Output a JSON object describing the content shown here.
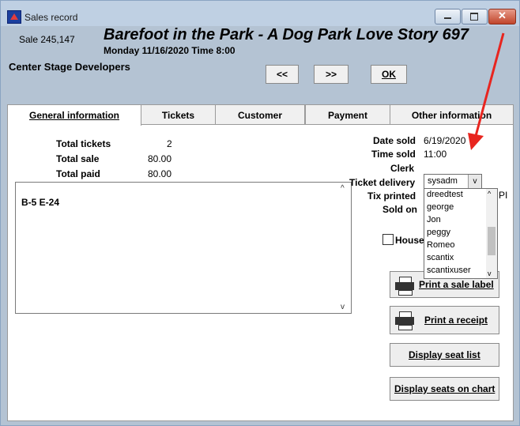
{
  "window": {
    "title": "Sales record"
  },
  "header": {
    "sale_number": "Sale 245,147",
    "show_title": "Barefoot in the Park - A Dog Park Love Story 697",
    "show_datetime": "Monday 11/16/2020  Time 8:00",
    "company": "Center Stage Developers"
  },
  "nav": {
    "prev_label": "<<",
    "next_label": ">>",
    "ok_label": "OK"
  },
  "tabs": [
    {
      "label": "General information"
    },
    {
      "label": "Tickets"
    },
    {
      "label": "Customer"
    },
    {
      "label": "Payment"
    },
    {
      "label": "Other information"
    }
  ],
  "totals": {
    "tickets_label": "Total tickets",
    "tickets_value": "2",
    "sale_label": "Total sale",
    "sale_value": "80.00",
    "paid_label": "Total paid",
    "paid_value": "80.00"
  },
  "memo": {
    "text": "B-5 E-24"
  },
  "details": {
    "date_sold_label": "Date sold",
    "date_sold_value": "6/19/2020",
    "time_sold_label": "Time sold",
    "time_sold_value": "11:00",
    "clerk_label": "Clerk",
    "clerk_value": "sysadm",
    "ticket_delivery_label": "Ticket delivery",
    "tix_printed_label": "Tix printed",
    "tix_printed_cut": "e PI",
    "sold_on_label": "Sold on",
    "house_label": "House"
  },
  "clerk_options": [
    "dreedtest",
    "george",
    "Jon",
    "peggy",
    "Romeo",
    "scantix",
    "scantixuser"
  ],
  "actions": {
    "print_label": "Print a sale label",
    "print_receipt": "Print a receipt",
    "seat_list": "Display seat list",
    "seats_chart": "Display seats on chart"
  },
  "colors": {
    "annotation_arrow": "#e8251f",
    "panel": "#b4c3d3"
  }
}
